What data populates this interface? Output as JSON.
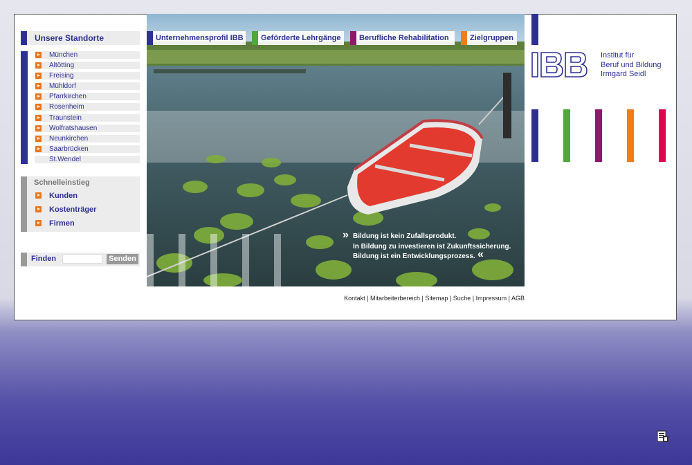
{
  "locations": {
    "title": "Unsere Standorte",
    "items": [
      "München",
      "Altötting",
      "Freising",
      "Mühldorf",
      "Pfarrkirchen",
      "Rosenheim",
      "Traunstein",
      "Wolfratshausen",
      "Neunkirchen",
      "Saarbrücken",
      "St.Wendel"
    ]
  },
  "quick_access": {
    "title": "Schnelleinstieg",
    "items": [
      "Kunden",
      "Kostenträger",
      "Firmen"
    ]
  },
  "search": {
    "label": "Finden",
    "placeholder": "",
    "button": "Senden"
  },
  "nav": {
    "tabs": [
      {
        "label": "Unternehmensprofil IBB",
        "color": "#2e3192"
      },
      {
        "label": "Geförderte Lehrgänge",
        "color": "#4ea83a"
      },
      {
        "label": "Berufliche Rehabilitation",
        "color": "#8b1a6b"
      },
      {
        "label": "Zielgruppen",
        "color": "#f07d1b"
      }
    ]
  },
  "slogan": {
    "line1": "Bildung ist kein Zufallsprodukt.",
    "line2": "In Bildung zu investieren ist Zukunftssicherung.",
    "line3": "Bildung ist ein Entwicklungsprozess."
  },
  "logo": {
    "mark": "IBB",
    "line1": "Institut für",
    "line2": "Beruf und Bildung",
    "line3": "Irmgard Seidl"
  },
  "brand_colors": [
    "#2e3192",
    "#4ea83a",
    "#8b1a6b",
    "#f07d1b",
    "#e5004f"
  ],
  "footer": {
    "links": [
      "Kontakt",
      "Mitarbeiterbereich",
      "Sitemap",
      "Suche",
      "Impressum",
      "AGB"
    ]
  }
}
